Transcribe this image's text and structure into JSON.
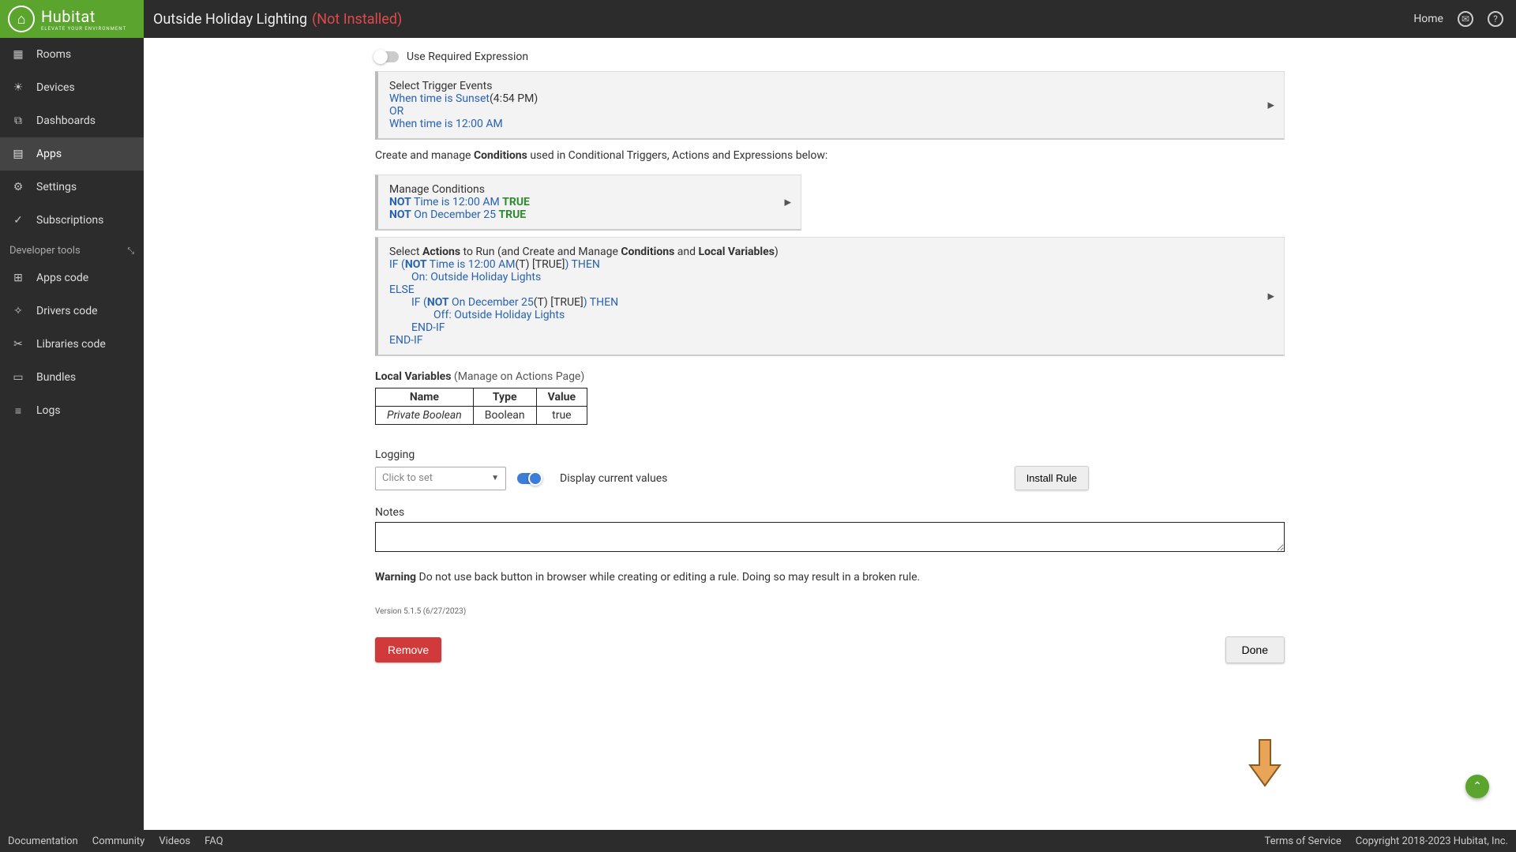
{
  "brand": {
    "name": "Hubitat",
    "tagline": "ELEVATE YOUR ENVIRONMENT"
  },
  "header": {
    "title": "Outside Holiday Lighting",
    "status": "(Not Installed)",
    "home": "Home"
  },
  "sidebar": {
    "items": [
      {
        "label": "Rooms"
      },
      {
        "label": "Devices"
      },
      {
        "label": "Dashboards"
      },
      {
        "label": "Apps"
      },
      {
        "label": "Settings"
      },
      {
        "label": "Subscriptions"
      }
    ],
    "devSection": "Developer tools",
    "devItems": [
      {
        "label": "Apps code"
      },
      {
        "label": "Drivers code"
      },
      {
        "label": "Libraries code"
      },
      {
        "label": "Bundles"
      },
      {
        "label": "Logs"
      }
    ]
  },
  "main": {
    "useRequiredExpression": "Use Required Expression",
    "triggers": {
      "title": "Select Trigger Events",
      "line1_text": "When time is Sunset",
      "line1_suffix": "(4:54 PM)",
      "or": "OR",
      "line2_text": "When time is 12:00 AM"
    },
    "conditionsIntro": {
      "pre": "Create and manage ",
      "bold": "Conditions",
      "post": " used in Conditional Triggers, Actions and Expressions below:"
    },
    "manageConditions": {
      "title": "Manage Conditions",
      "not": "NOT",
      "c1_text": " Time is 12:00 AM ",
      "c1_state": "TRUE",
      "c2_text": " On December 25 ",
      "c2_state": "TRUE"
    },
    "actionsHeader": {
      "p1": "Select ",
      "b1": "Actions",
      "p2": " to Run (and Create and Manage ",
      "b2": "Conditions",
      "p3": " and ",
      "b3": "Local Variables",
      "p4": ")"
    },
    "actions": {
      "l1_pre": "IF (",
      "l1_not": "NOT",
      "l1_mid": " Time is 12:00 AM",
      "l1_suffix": "(T) [TRUE]",
      "l1_then": ") THEN",
      "l2": "On: Outside Holiday Lights",
      "l3": "ELSE",
      "l4_pre": "IF (",
      "l4_not": "NOT",
      "l4_mid": " On December 25",
      "l4_suffix": "(T) [TRUE]",
      "l4_then": ") THEN",
      "l5": "Off: Outside Holiday Lights",
      "l6": "END-IF",
      "l7": "END-IF"
    },
    "localVars": {
      "title": "Local Variables",
      "sub": " (Manage on Actions Page)",
      "headers": {
        "name": "Name",
        "type": "Type",
        "value": "Value"
      },
      "row": {
        "name": "Private Boolean",
        "type": "Boolean",
        "value": "true"
      }
    },
    "logging": {
      "label": "Logging",
      "placeholder": "Click to set",
      "displayCurrent": "Display current values",
      "installRule": "Install Rule"
    },
    "notes": {
      "label": "Notes"
    },
    "warning": {
      "bold": "Warning",
      "text": " Do not use back button in browser while creating or editing a rule. Doing so may result in a broken rule."
    },
    "version": "Version 5.1.5 (6/27/2023)",
    "remove": "Remove",
    "done": "Done"
  },
  "footer": {
    "left": [
      "Documentation",
      "Community",
      "Videos",
      "FAQ"
    ],
    "right": [
      "Terms of Service",
      "Copyright 2018-2023 Hubitat, Inc."
    ]
  }
}
